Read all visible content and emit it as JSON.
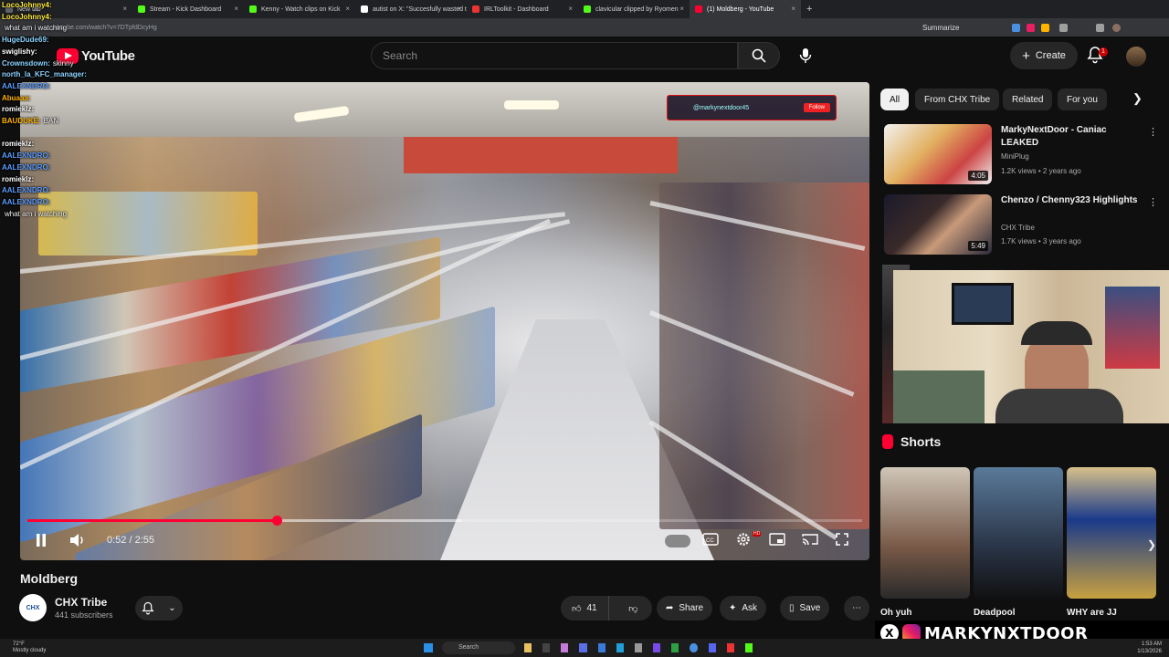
{
  "browser": {
    "tabs": [
      {
        "label": "New tab",
        "color": "#5f6368"
      },
      {
        "label": "Stream - Kick Dashboard",
        "color": "#53fc18"
      },
      {
        "label": "Kenny - Watch clips on Kick",
        "color": "#53fc18"
      },
      {
        "label": "autist on X: \"Succesfully wasted th",
        "color": "#ffffff"
      },
      {
        "label": "IRLToolkit - Dashboard",
        "color": "#e33"
      },
      {
        "label": "clavicular clipped by Ryomen",
        "color": "#53fc18"
      },
      {
        "label": "(1) Moldberg - YouTube",
        "color": "#ff0033",
        "active": true
      }
    ],
    "new_tab_symbol": "+",
    "url": "youtube.com/watch?v=7DTpfdDcyHg",
    "summarize_label": "Summarize"
  },
  "header": {
    "logo_text": "YouTube",
    "search_placeholder": "Search",
    "create_label": "Create",
    "notification_count": "1"
  },
  "chat": [
    {
      "user": "LocoJohnny4:",
      "text": "",
      "color": "#ffeb3b"
    },
    {
      "user": "LocoJohnny4:",
      "text": "",
      "color": "#ffeb3b"
    },
    {
      "user": "",
      "text": "what am i watching",
      "color": "#ffffff"
    },
    {
      "user": "HugeDude69:",
      "text": "",
      "color": "#8bd3ff"
    },
    {
      "user": "swiglishy:",
      "text": "",
      "color": "#ffffff"
    },
    {
      "user": "Crownsdown:",
      "text": "skinny",
      "color": "#8bd3ff"
    },
    {
      "user": "north_la_KFC_manager:",
      "text": "",
      "color": "#8bd3ff"
    },
    {
      "user": "AALEXNDRO:",
      "text": "",
      "color": "#5a9cff"
    },
    {
      "user": "Abuaaa:",
      "text": "",
      "color": "#ffb300"
    },
    {
      "user": "romieklz:",
      "text": "",
      "color": "#ffffff"
    },
    {
      "user": "BAUDUKE:",
      "text": "BAN",
      "color": "#ffb300"
    },
    {
      "user": "",
      "text": "",
      "color": "#ff5252"
    },
    {
      "user": "romieklz:",
      "text": "",
      "color": "#ffffff"
    },
    {
      "user": "AALEXNDRO:",
      "text": "",
      "color": "#5a9cff"
    },
    {
      "user": "AALEXNDRO:",
      "text": "",
      "color": "#5a9cff"
    },
    {
      "user": "romieklz:",
      "text": "",
      "color": "#ffffff"
    },
    {
      "user": "AALEXNDRO:",
      "text": "",
      "color": "#5a9cff"
    },
    {
      "user": "AALEXNDRO:",
      "text": "",
      "color": "#5a9cff"
    },
    {
      "user": "",
      "text": "what am i watching",
      "color": "#ffffff"
    }
  ],
  "video": {
    "tiktok_handle": "@markynextdoor45",
    "tiktok_follow": "Follow",
    "current_time": "0:52",
    "duration": "2:55",
    "played_fraction": 0.299,
    "buffered_fraction": 0.52,
    "title": "Moldberg"
  },
  "channel": {
    "name": "CHX Tribe",
    "subscribers": "441 subscribers",
    "avatar_text": "CHX"
  },
  "actions": {
    "like_count": "41",
    "share_label": "Share",
    "ask_label": "Ask",
    "save_label": "Save"
  },
  "chips": [
    "All",
    "From CHX Tribe",
    "Related",
    "For you"
  ],
  "recommendations": [
    {
      "title": "MarkyNextDoor - Caniac LEAKED",
      "channel": "MiniPlug",
      "meta": "1.2K views • 2 years ago",
      "duration": "4:05"
    },
    {
      "title": "Chenzo / Chenny323 Highlights",
      "channel": "CHX Tribe",
      "meta": "1.7K views • 3 years ago",
      "duration": "5:49"
    }
  ],
  "shorts": {
    "heading": "Shorts",
    "items": [
      {
        "title": "Oh yuh"
      },
      {
        "title": "Deadpool"
      },
      {
        "title": "WHY are JJ"
      }
    ]
  },
  "overlay_name": "MARKYNXTDOOR",
  "taskbar": {
    "weather": "72°F",
    "weather_desc": "Mostly cloudy",
    "search_label": "Search",
    "clock_time": "1:53 AM",
    "clock_date": "1/13/2026"
  }
}
